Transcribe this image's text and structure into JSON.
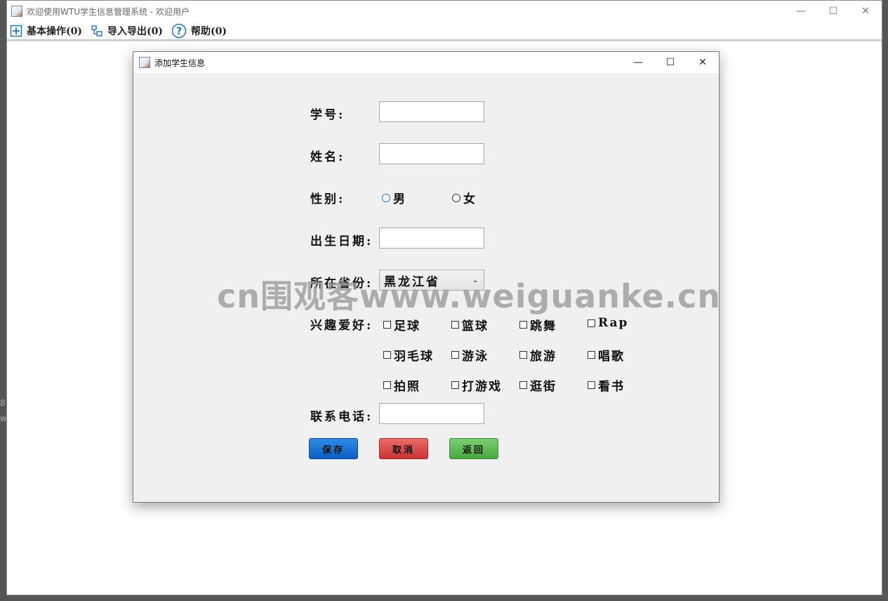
{
  "main_window": {
    "title": "欢迎使用WTU学生信息管理系统 - 欢迎用户",
    "menu": [
      {
        "label": "基本操作(0)",
        "icon": "plus-box-icon"
      },
      {
        "label": "导入导出(0)",
        "icon": "tree-icon"
      },
      {
        "label": "帮助(0)",
        "icon": "help-icon"
      }
    ],
    "controls": {
      "minimize": "—",
      "maximize": "☐",
      "close": "✕"
    }
  },
  "dialog": {
    "title": "添加学生信息",
    "controls": {
      "minimize": "—",
      "maximize": "☐",
      "close": "✕"
    },
    "labels": {
      "student_id": "学号:",
      "name": "姓名:",
      "gender": "性别:",
      "birth_date": "出生日期:",
      "province": "所在省份:",
      "hobbies": "兴趣爱好:",
      "phone": "联系电话:"
    },
    "fields": {
      "student_id": "",
      "name": "",
      "birth_date": "",
      "phone": ""
    },
    "gender_options": [
      "男",
      "女"
    ],
    "province_selected": "黑龙江省",
    "hobbies": [
      "足球",
      "篮球",
      "跳舞",
      "Rap",
      "羽毛球",
      "游泳",
      "旅游",
      "唱歌",
      "拍照",
      "打游戏",
      "逛街",
      "看书"
    ],
    "buttons": {
      "save": "保存",
      "cancel": "取消",
      "back": "返回"
    },
    "button_colors": {
      "save": "#1f75d6",
      "cancel": "#dd4d4d",
      "back": "#5bbb52"
    }
  },
  "watermark": "cn围观客www.weiguanke.cn",
  "side_chars": [
    "8",
    "w"
  ]
}
